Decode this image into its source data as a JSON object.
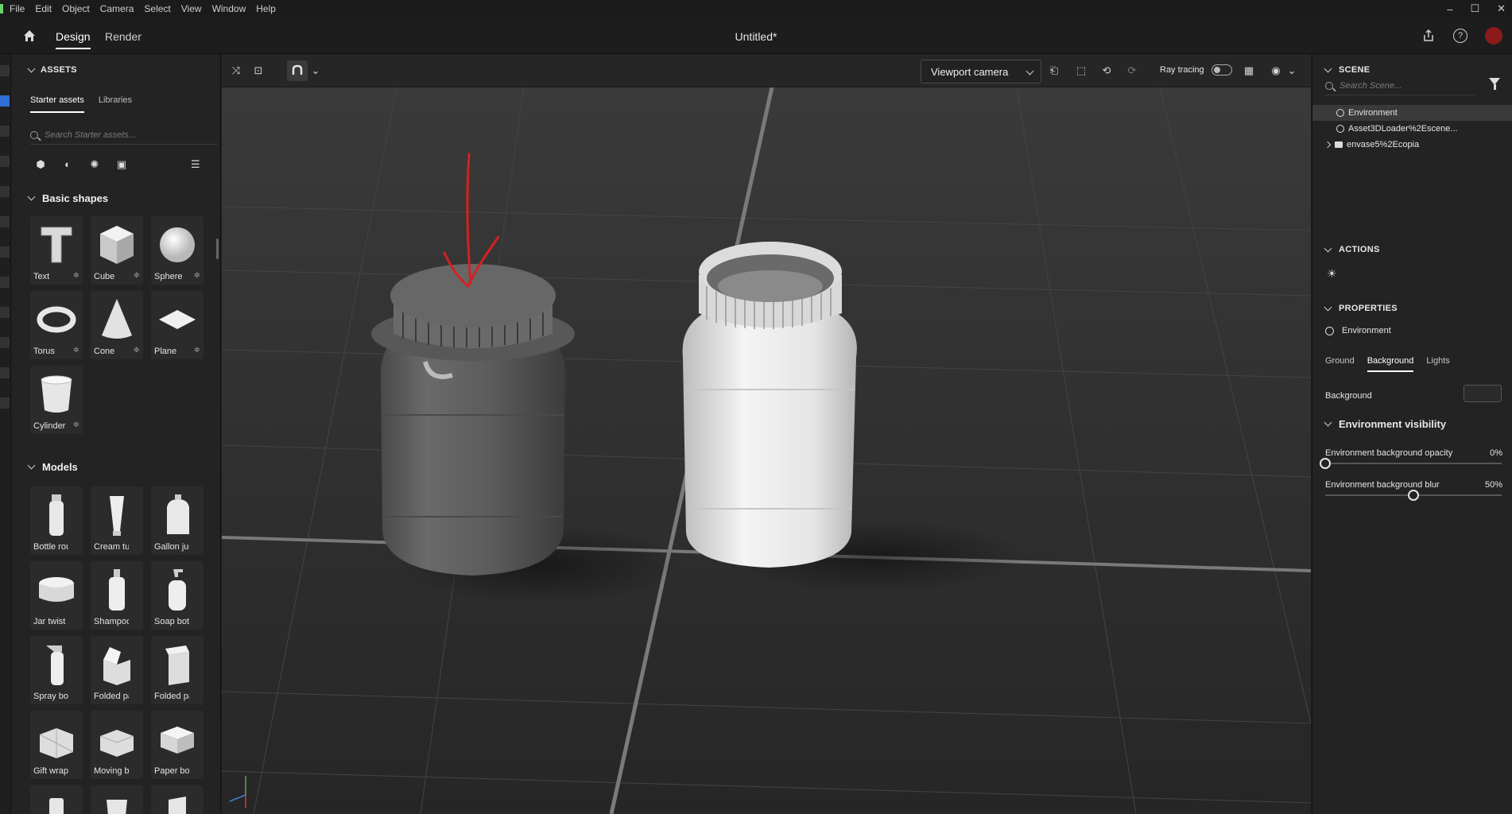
{
  "menu": [
    "File",
    "Edit",
    "Object",
    "Camera",
    "Select",
    "View",
    "Window",
    "Help"
  ],
  "window_controls": {
    "minimize": "–",
    "maximize": "☐",
    "close": "✕"
  },
  "appbar": {
    "tabs": [
      "Design",
      "Render"
    ],
    "active_tab": "Design",
    "doc_title": "Untitled*"
  },
  "assets": {
    "header": "ASSETS",
    "subtabs": [
      "Starter assets",
      "Libraries"
    ],
    "active_subtab": "Starter assets",
    "search_placeholder": "Search Starter assets...",
    "groups": {
      "basic": {
        "title": "Basic shapes",
        "items": [
          "Text",
          "Cube",
          "Sphere",
          "Torus",
          "Cone",
          "Plane",
          "Cylinder"
        ]
      },
      "models": {
        "title": "Models",
        "items": [
          "Bottle rou...",
          "Cream tube",
          "Gallon jug",
          "Jar twist s...",
          "Shampoo ...",
          "Soap bottle",
          "Spray bott...",
          "Folded pa...",
          "Folded pa...",
          "Gift wrapp...",
          "Moving bo...",
          "Paper box ..."
        ]
      }
    }
  },
  "viewport": {
    "camera": "Viewport camera",
    "raytracing_label": "Ray tracing",
    "raytracing_on": false
  },
  "scene": {
    "header": "SCENE",
    "search_placeholder": "Search Scene...",
    "tree": [
      "Environment",
      "Asset3DLoader%2Escene...",
      "envase5%2Ecopia"
    ],
    "selected": "Environment"
  },
  "actions": {
    "header": "ACTIONS"
  },
  "properties": {
    "header": "PROPERTIES",
    "object": "Environment",
    "tabs": [
      "Ground",
      "Background",
      "Lights"
    ],
    "active_tab": "Background",
    "background_label": "Background",
    "env_visibility": "Environment visibility",
    "sliders": [
      {
        "label": "Environment background opacity",
        "value_text": "0%",
        "value": 0
      },
      {
        "label": "Environment background blur",
        "value_text": "50%",
        "value": 50
      }
    ]
  },
  "colors": {
    "accent": "#2f6fd6",
    "annotation_arrow": "#d62020",
    "avatar": "#8b1a1a"
  }
}
